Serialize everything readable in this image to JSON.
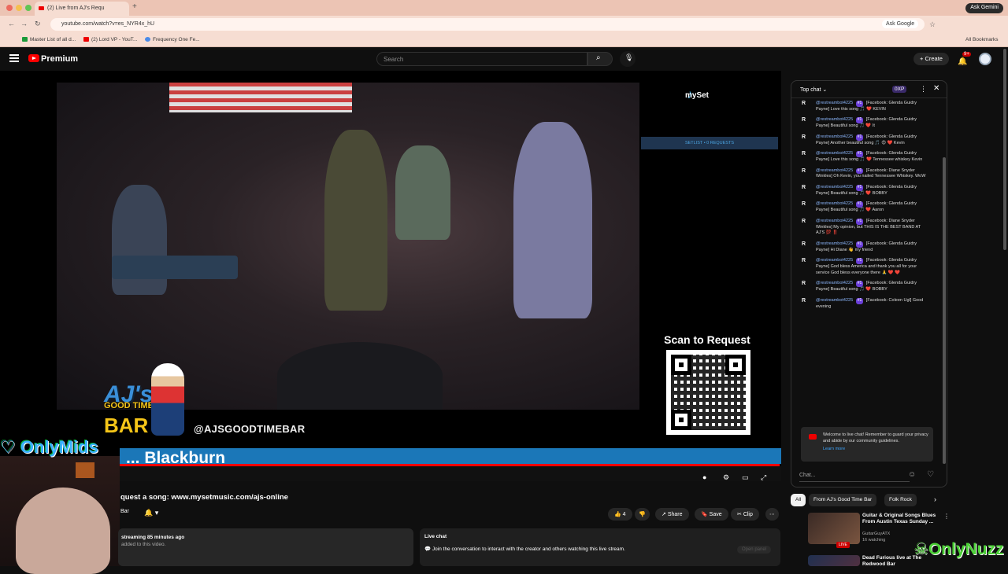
{
  "browser": {
    "tab_title": "(2) Live from AJ's Requ",
    "url": "youtube.com/watch?v=es_NYR4x_hU",
    "ask_gemini": "Ask Gemini",
    "ask_google": "Ask Google",
    "bookmarks": [
      "Master List of all d...",
      "(2) Lord VP - YouT...",
      "Frequency One Fe..."
    ],
    "all_bookmarks": "All Bookmarks"
  },
  "header": {
    "brand": "Premium",
    "search_placeholder": "Search",
    "create_label": "Create",
    "notif_count": "9+"
  },
  "player": {
    "myset_label": "mySet",
    "setlist_label": "SETLIST • 0 REQUESTS",
    "scan_label": "Scan to Request",
    "logo_aj": "AJ's",
    "logo_good_time": "GOOD TIME",
    "logo_bar": "BAR",
    "handle": "@AJSGOODTIMEBAR",
    "scroll_name": "... Blackburn",
    "onlymids": "OnlyMids"
  },
  "video": {
    "title_visible": "quest a song: www.mysetmusic.com/ajs-online",
    "channel_visible": "Bar",
    "likes": "4",
    "share_label": "Share",
    "save_label": "Save",
    "clip_label": "Clip",
    "desc_line1": "streaming 85 minutes ago",
    "desc_line2": "added to this video.",
    "livechat_title": "Live chat",
    "livechat_text": "Join the conversation to interact with the creator and others watching this live stream.",
    "open_panel": "Open panel"
  },
  "chat": {
    "mode_label": "Top chat",
    "points_label": "0XP",
    "messages": [
      {
        "author": "@restreambot4225",
        "src": "[Facebook:",
        "text": "Glenda Guidry Payne] Love this song 🎵 ❤️ KEVIN"
      },
      {
        "author": "@restreambot4225",
        "src": "[Facebook:",
        "text": "Glenda Guidry Payne] Beautiful song 🎵 ❤️ It"
      },
      {
        "author": "@restreambot4225",
        "src": "[Facebook:",
        "text": "Glenda Guidry Payne] Another beautiful song 🎵 😍 ❤️ Kevin"
      },
      {
        "author": "@restreambot4225",
        "src": "[Facebook:",
        "text": "Glenda Guidry Payne] Love this song 🎵 ❤️ Tennessee whiskey Kevin"
      },
      {
        "author": "@restreambot4225",
        "src": "[Facebook:",
        "text": "Diane Snyder Winkles] Oh Kevin, you nailed Tennessee Whiskey. WoW"
      },
      {
        "author": "@restreambot4225",
        "src": "[Facebook:",
        "text": "Glenda Guidry Payne] Beautiful song 🎵 ❤️ BOBBY"
      },
      {
        "author": "@restreambot4225",
        "src": "[Facebook:",
        "text": "Glenda Guidry Payne] Beautiful song 🎵 ❤️ Aaron"
      },
      {
        "author": "@restreambot4225",
        "src": "[Facebook:",
        "text": "Diane Snyder Winkles] My opinion, but THIS IS THE BEST BAND AT AJ'S 💯 ‼️"
      },
      {
        "author": "@restreambot4225",
        "src": "[Facebook:",
        "text": "Glenda Guidry Payne] Hi Diane 👋 my friend"
      },
      {
        "author": "@restreambot4225",
        "src": "[Facebook:",
        "text": "Glenda Guidry Payne] God bless America and thank you all for your service God bless everyone there 🙏 ❤️ ❤️"
      },
      {
        "author": "@restreambot4225",
        "src": "[Facebook:",
        "text": "Glenda Guidry Payne] Beautiful song 🎵 ❤️ BOBBY"
      },
      {
        "author": "@restreambot4225",
        "src": "[Facebook:",
        "text": "Coleen Ugl] Good evening"
      }
    ],
    "notice": "Welcome to live chat! Remember to guard your privacy and abide by our community guidelines.",
    "learn_more": "Learn more",
    "input_placeholder": "Chat..."
  },
  "chips": [
    "All",
    "From AJ's Good Time Bar",
    "Folk Rock"
  ],
  "recs": [
    {
      "title": "Guitar & Original Songs Blues From Austin Texas Sunday ...",
      "channel": "GuitarGuyATX",
      "watching": "16 watching",
      "badge": "LIVE"
    },
    {
      "title": "Dead Furious live at The Redwood Bar",
      "channel": "",
      "watching": ""
    }
  ],
  "overlay_brand": "OnlyNuzz",
  "colors": {
    "accent": "#ff0000",
    "strip": "#1b77b8",
    "gold": "#f5c518",
    "link": "#3ea6ff"
  }
}
